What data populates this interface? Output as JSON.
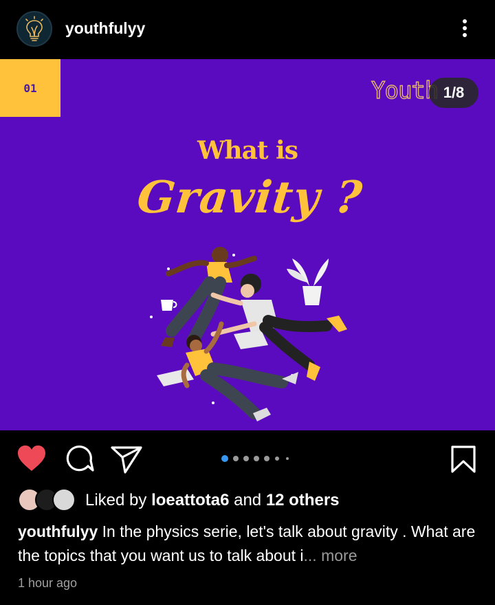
{
  "header": {
    "username": "youthfulyy",
    "avatar_icon": "lightbulb-icon",
    "menu_icon": "more-vertical-icon"
  },
  "post": {
    "slide_tag": "01",
    "brand_text": "Youth",
    "counter": "1/8",
    "title_line1": "What is",
    "title_line2": "Gravity ?",
    "background_color": "#5b0bbf",
    "accent_color": "#ffc23a"
  },
  "actions": {
    "like_icon": "heart-filled-icon",
    "comment_icon": "comment-icon",
    "share_icon": "send-icon",
    "save_icon": "bookmark-icon",
    "like_color": "#ed4956",
    "active_dot_color": "#3897f0",
    "carousel_position": 1,
    "carousel_visible_dots": 7
  },
  "likes": {
    "prefix": "Liked by ",
    "user": "loeattota6",
    "middle": " and ",
    "others": "12 others"
  },
  "caption": {
    "username": "youthfulyy",
    "text": " In the physics serie, let's talk about gravity . What are the topics that you want us to talk about i",
    "ellipsis": "...",
    "more": " more"
  },
  "timestamp": "1 hour ago"
}
